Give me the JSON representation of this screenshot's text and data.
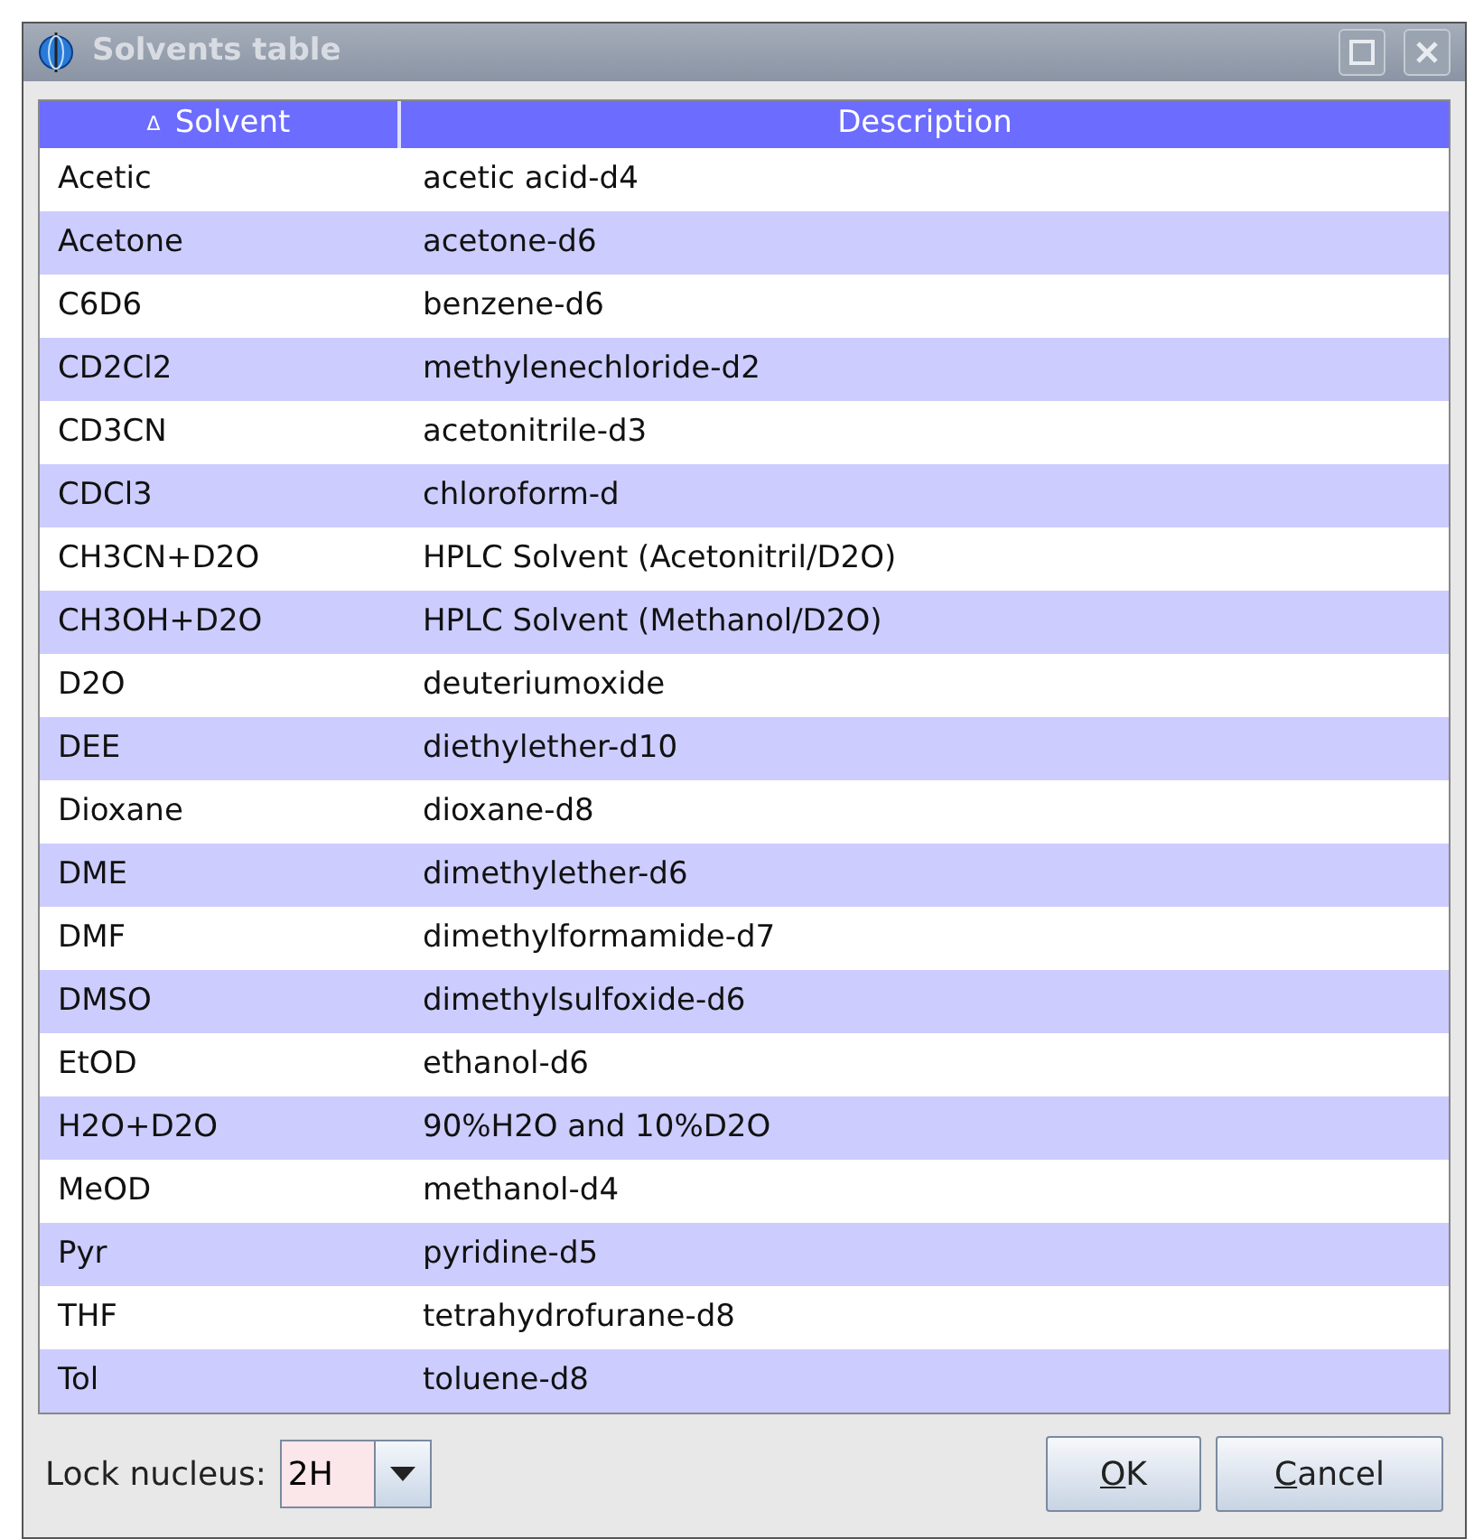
{
  "window": {
    "title": "Solvents table"
  },
  "table": {
    "columns": [
      {
        "label": "Solvent",
        "sort_mark": "Δ"
      },
      {
        "label": "Description"
      }
    ],
    "rows": [
      {
        "solvent": "Acetic",
        "description": "acetic acid-d4"
      },
      {
        "solvent": "Acetone",
        "description": "acetone-d6"
      },
      {
        "solvent": "C6D6",
        "description": "benzene-d6"
      },
      {
        "solvent": "CD2Cl2",
        "description": "methylenechloride-d2"
      },
      {
        "solvent": "CD3CN",
        "description": "acetonitrile-d3"
      },
      {
        "solvent": "CDCl3",
        "description": "chloroform-d"
      },
      {
        "solvent": "CH3CN+D2O",
        "description": "HPLC Solvent (Acetonitril/D2O)"
      },
      {
        "solvent": "CH3OH+D2O",
        "description": "HPLC Solvent (Methanol/D2O)"
      },
      {
        "solvent": "D2O",
        "description": "deuteriumoxide"
      },
      {
        "solvent": "DEE",
        "description": "diethylether-d10"
      },
      {
        "solvent": "Dioxane",
        "description": "dioxane-d8"
      },
      {
        "solvent": "DME",
        "description": "dimethylether-d6"
      },
      {
        "solvent": "DMF",
        "description": "dimethylformamide-d7"
      },
      {
        "solvent": "DMSO",
        "description": "dimethylsulfoxide-d6"
      },
      {
        "solvent": "EtOD",
        "description": "ethanol-d6"
      },
      {
        "solvent": "H2O+D2O",
        "description": "90%H2O and 10%D2O"
      },
      {
        "solvent": "MeOD",
        "description": "methanol-d4"
      },
      {
        "solvent": "Pyr",
        "description": "pyridine-d5"
      },
      {
        "solvent": "THF",
        "description": "tetrahydrofurane-d8"
      },
      {
        "solvent": "Tol",
        "description": "toluene-d8"
      }
    ]
  },
  "lock_nucleus": {
    "label": "Lock nucleus:",
    "value": "2H"
  },
  "buttons": [
    {
      "label": "OK",
      "mnemonic_underlined": true
    },
    {
      "label": "Cancel",
      "mnemonic_underlined": true
    }
  ]
}
